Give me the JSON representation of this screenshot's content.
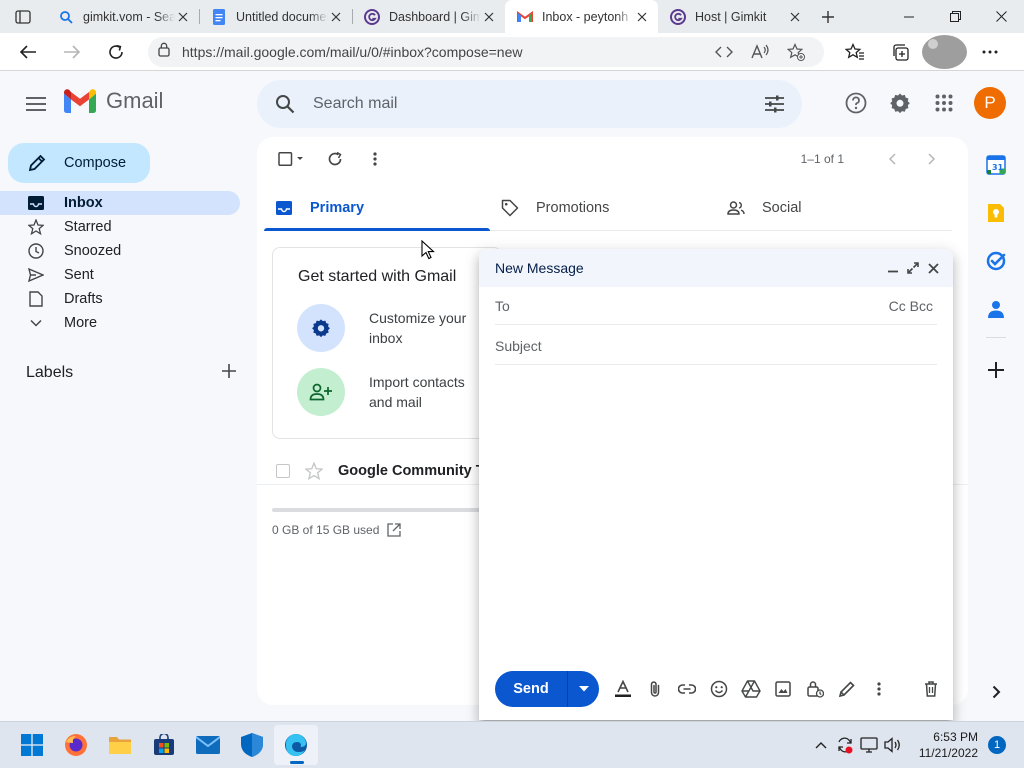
{
  "browser": {
    "tabs": [
      {
        "title": "gimkit.vom - Search",
        "icon": "search-icon",
        "active": false
      },
      {
        "title": "Untitled document",
        "icon": "docs-icon",
        "active": false
      },
      {
        "title": "Dashboard | Gimkit",
        "icon": "gimkit-icon",
        "active": false
      },
      {
        "title": "Inbox - peytonh",
        "icon": "gmail-icon",
        "active": true
      },
      {
        "title": "Host | Gimkit",
        "icon": "gimkit-icon",
        "active": false
      }
    ],
    "url": "https://mail.google.com/mail/u/0/#inbox?compose=new"
  },
  "gmail": {
    "brand": "Gmail",
    "search_placeholder": "Search mail",
    "account_initial": "P",
    "compose_label": "Compose",
    "nav": [
      {
        "label": "Inbox",
        "icon": "inbox-icon",
        "selected": true
      },
      {
        "label": "Starred",
        "icon": "star-icon",
        "selected": false
      },
      {
        "label": "Snoozed",
        "icon": "clock-icon",
        "selected": false
      },
      {
        "label": "Sent",
        "icon": "send-icon",
        "selected": false
      },
      {
        "label": "Drafts",
        "icon": "draft-icon",
        "selected": false
      },
      {
        "label": "More",
        "icon": "chevron-down-icon",
        "selected": false
      }
    ],
    "labels_heading": "Labels",
    "pager_text": "1–1 of 1",
    "category_tabs": [
      {
        "label": "Primary",
        "icon": "inbox-tab-icon",
        "selected": true
      },
      {
        "label": "Promotions",
        "icon": "tag-icon",
        "selected": false
      },
      {
        "label": "Social",
        "icon": "people-icon",
        "selected": false
      }
    ],
    "get_started": {
      "title": "Get started with Gmail",
      "items": [
        {
          "text": "Customize your inbox",
          "icon": "gear-icon",
          "color": "#d3e3fd"
        },
        {
          "text": "Import contacts and mail",
          "icon": "add-contact-icon",
          "color": "#c4eed0"
        }
      ]
    },
    "messages": [
      {
        "sender": "Google Community Te"
      }
    ],
    "storage_text": "0 GB of 15 GB used"
  },
  "compose_window": {
    "title": "New Message",
    "to_label": "To",
    "cc_bcc": "Cc Bcc",
    "subject_placeholder": "Subject",
    "send_label": "Send"
  },
  "taskbar": {
    "time": "6:53 PM",
    "date": "11/21/2022",
    "notification_count": "1"
  },
  "colors": {
    "accent": "#0b57d0",
    "compose_bg": "#c2e7ff",
    "selected_nav": "#d3e3fd",
    "account": "#ef6c00"
  }
}
